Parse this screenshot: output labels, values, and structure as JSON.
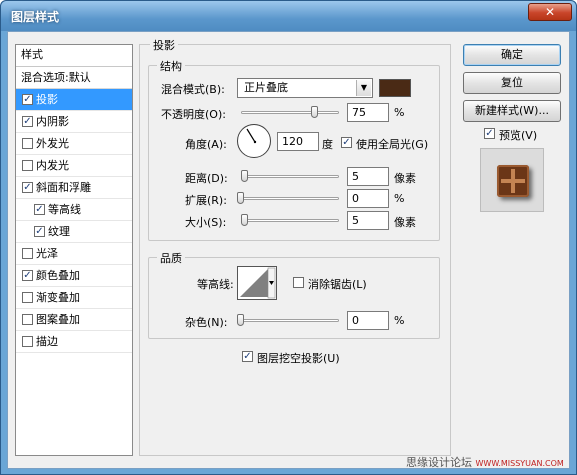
{
  "window": {
    "title": "图层样式",
    "close_glyph": "✕"
  },
  "styles": {
    "header": "样式",
    "blend_default": "混合选项:默认",
    "items": [
      {
        "label": "投影",
        "checked": true,
        "selected": true,
        "sub": false
      },
      {
        "label": "内阴影",
        "checked": true,
        "selected": false,
        "sub": false
      },
      {
        "label": "外发光",
        "checked": false,
        "selected": false,
        "sub": false
      },
      {
        "label": "内发光",
        "checked": false,
        "selected": false,
        "sub": false
      },
      {
        "label": "斜面和浮雕",
        "checked": true,
        "selected": false,
        "sub": false
      },
      {
        "label": "等高线",
        "checked": true,
        "selected": false,
        "sub": true
      },
      {
        "label": "纹理",
        "checked": true,
        "selected": false,
        "sub": true
      },
      {
        "label": "光泽",
        "checked": false,
        "selected": false,
        "sub": false
      },
      {
        "label": "颜色叠加",
        "checked": true,
        "selected": false,
        "sub": false
      },
      {
        "label": "渐变叠加",
        "checked": false,
        "selected": false,
        "sub": false
      },
      {
        "label": "图案叠加",
        "checked": false,
        "selected": false,
        "sub": false
      },
      {
        "label": "描边",
        "checked": false,
        "selected": false,
        "sub": false
      }
    ]
  },
  "panel": {
    "title": "投影",
    "structure": {
      "title": "结构",
      "blend_mode_label": "混合模式(B):",
      "blend_mode_value": "正片叠底",
      "shadow_color": "#4a2a15",
      "opacity_label": "不透明度(O):",
      "opacity_value": "75",
      "opacity_unit": "%",
      "opacity_level": 0.75,
      "angle_label": "角度(A):",
      "angle_value": "120",
      "angle_unit": "度",
      "global_light_label": "使用全局光(G)",
      "global_light_checked": true,
      "distance_label": "距离(D):",
      "distance_value": "5",
      "distance_unit": "像素",
      "spread_label": "扩展(R):",
      "spread_value": "0",
      "spread_unit": "%",
      "size_label": "大小(S):",
      "size_value": "5",
      "size_unit": "像素"
    },
    "quality": {
      "title": "品质",
      "contour_label": "等高线:",
      "antialias_label": "消除锯齿(L)",
      "antialias_checked": false,
      "noise_label": "杂色(N):",
      "noise_value": "0",
      "noise_unit": "%"
    },
    "knockout_label": "图层挖空投影(U)",
    "knockout_checked": true
  },
  "buttons": {
    "ok": "确定",
    "reset": "复位",
    "new_style": "新建样式(W)...",
    "preview_label": "预览(V)",
    "preview_checked": true
  },
  "watermark": {
    "text": "思缘设计论坛",
    "small": "WWW.MISSYUAN.COM"
  }
}
